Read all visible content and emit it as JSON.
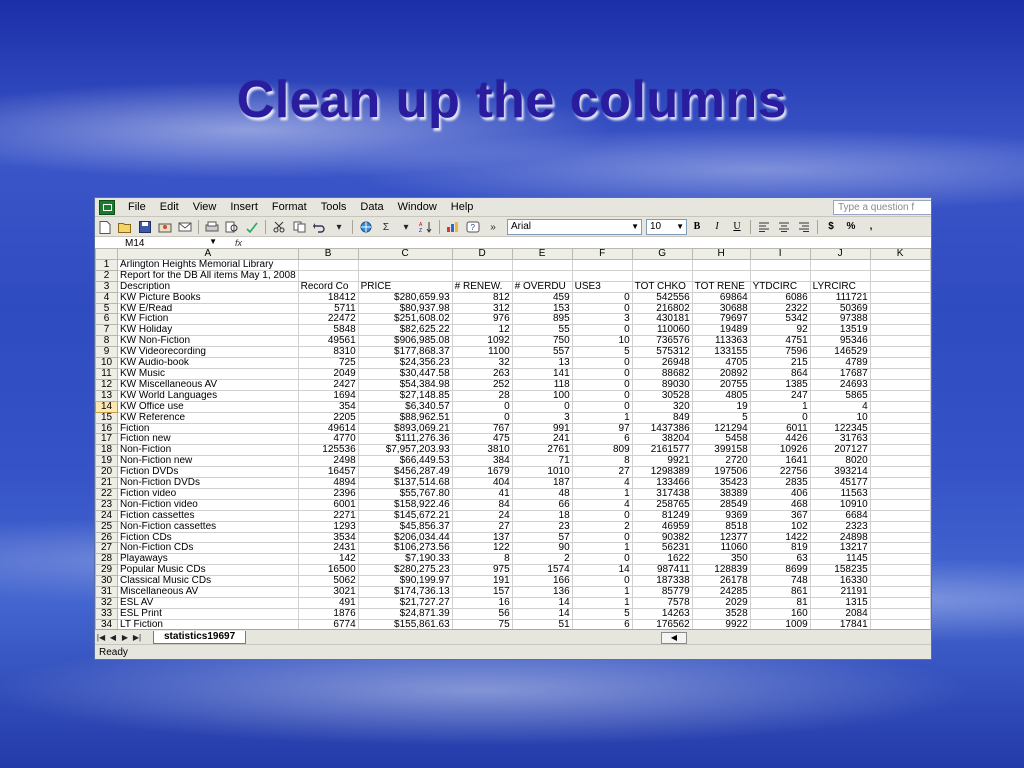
{
  "slide": {
    "title": "Clean up the columns"
  },
  "excel": {
    "menu": [
      "File",
      "Edit",
      "View",
      "Insert",
      "Format",
      "Tools",
      "Data",
      "Window",
      "Help"
    ],
    "question_placeholder": "Type a question f",
    "toolbar": {
      "font": "Arial",
      "font_size": "10",
      "bold": "B",
      "italic": "I",
      "underline": "U",
      "currency": "$",
      "percent": "%",
      "comma": ","
    },
    "name_box": "M14",
    "fx": "fx",
    "columns": [
      "A",
      "B",
      "C",
      "D",
      "E",
      "F",
      "G",
      "H",
      "I",
      "J",
      "K"
    ],
    "active_row": 14,
    "rows": [
      {
        "n": "1",
        "c": [
          "Arlington Heights Memorial Library",
          "",
          "",
          "",
          "",
          "",
          "",
          "",
          "",
          "",
          ""
        ]
      },
      {
        "n": "2",
        "c": [
          "Report for the DB All items May 1, 2008",
          "",
          "",
          "",
          "",
          "",
          "",
          "",
          "",
          "",
          ""
        ]
      },
      {
        "n": "3",
        "c": [
          "Description",
          "Record Co",
          "PRICE",
          "# RENEW.",
          "# OVERDU",
          "USE3",
          "TOT CHKO",
          "TOT RENE",
          "YTDCIRC",
          "LYRCIRC",
          ""
        ]
      },
      {
        "n": "4",
        "c": [
          "KW Picture Books",
          "18412",
          "$280,659.93",
          "812",
          "459",
          "0",
          "542556",
          "69864",
          "6086",
          "111721",
          ""
        ]
      },
      {
        "n": "5",
        "c": [
          "KW E/Read",
          "5711",
          "$80,937.98",
          "312",
          "153",
          "0",
          "216802",
          "30688",
          "2322",
          "50369",
          ""
        ]
      },
      {
        "n": "6",
        "c": [
          "KW Fiction",
          "22472",
          "$251,608.02",
          "976",
          "895",
          "3",
          "430181",
          "79697",
          "5342",
          "97388",
          ""
        ]
      },
      {
        "n": "7",
        "c": [
          "KW Holiday",
          "5848",
          "$82,625.22",
          "12",
          "55",
          "0",
          "110060",
          "19489",
          "92",
          "13519",
          ""
        ]
      },
      {
        "n": "8",
        "c": [
          "KW Non-Fiction",
          "49561",
          "$906,985.08",
          "1092",
          "750",
          "10",
          "736576",
          "113363",
          "4751",
          "95346",
          ""
        ]
      },
      {
        "n": "9",
        "c": [
          "KW Videorecording",
          "8310",
          "$177,868.37",
          "1100",
          "557",
          "5",
          "575312",
          "133155",
          "7596",
          "146529",
          ""
        ]
      },
      {
        "n": "10",
        "c": [
          "KW Audio-book",
          "725",
          "$24,356.23",
          "32",
          "13",
          "0",
          "26948",
          "4705",
          "215",
          "4789",
          ""
        ]
      },
      {
        "n": "11",
        "c": [
          "KW Music",
          "2049",
          "$30,447.58",
          "263",
          "141",
          "0",
          "88682",
          "20892",
          "864",
          "17687",
          ""
        ]
      },
      {
        "n": "12",
        "c": [
          "KW Miscellaneous AV",
          "2427",
          "$54,384.98",
          "252",
          "118",
          "0",
          "89030",
          "20755",
          "1385",
          "24693",
          ""
        ]
      },
      {
        "n": "13",
        "c": [
          "KW World Languages",
          "1694",
          "$27,148.85",
          "28",
          "100",
          "0",
          "30528",
          "4805",
          "247",
          "5865",
          ""
        ]
      },
      {
        "n": "14",
        "c": [
          "KW Office use",
          "354",
          "$6,340.57",
          "0",
          "0",
          "0",
          "320",
          "19",
          "1",
          "4",
          ""
        ]
      },
      {
        "n": "15",
        "c": [
          "KW Reference",
          "2205",
          "$88,962.51",
          "0",
          "3",
          "1",
          "849",
          "5",
          "0",
          "10",
          ""
        ]
      },
      {
        "n": "16",
        "c": [
          "Fiction",
          "49614",
          "$893,069.21",
          "767",
          "991",
          "97",
          "1437386",
          "121294",
          "6011",
          "122345",
          ""
        ]
      },
      {
        "n": "17",
        "c": [
          "Fiction new",
          "4770",
          "$111,276.36",
          "475",
          "241",
          "6",
          "38204",
          "5458",
          "4426",
          "31763",
          ""
        ]
      },
      {
        "n": "18",
        "c": [
          "Non-Fiction",
          "125536",
          "$7,957,203.93",
          "3810",
          "2761",
          "809",
          "2161577",
          "399158",
          "10926",
          "207127",
          ""
        ]
      },
      {
        "n": "19",
        "c": [
          "Non-Fiction new",
          "2498",
          "$66,449.53",
          "384",
          "71",
          "8",
          "9921",
          "2720",
          "1641",
          "8020",
          ""
        ]
      },
      {
        "n": "20",
        "c": [
          "Fiction DVDs",
          "16457",
          "$456,287.49",
          "1679",
          "1010",
          "27",
          "1298389",
          "197506",
          "22756",
          "393214",
          ""
        ]
      },
      {
        "n": "21",
        "c": [
          "Non-Fiction DVDs",
          "4894",
          "$137,514.68",
          "404",
          "187",
          "4",
          "133466",
          "35423",
          "2835",
          "45177",
          ""
        ]
      },
      {
        "n": "22",
        "c": [
          "Fiction video",
          "2396",
          "$55,767.80",
          "41",
          "48",
          "1",
          "317438",
          "38389",
          "406",
          "11563",
          ""
        ]
      },
      {
        "n": "23",
        "c": [
          "Non-Fiction video",
          "6001",
          "$158,922.46",
          "84",
          "66",
          "4",
          "258765",
          "28549",
          "468",
          "10910",
          ""
        ]
      },
      {
        "n": "24",
        "c": [
          "Fiction cassettes",
          "2271",
          "$145,672.21",
          "24",
          "18",
          "0",
          "81249",
          "9369",
          "367",
          "6684",
          ""
        ]
      },
      {
        "n": "25",
        "c": [
          "Non-Fiction cassettes",
          "1293",
          "$45,856.37",
          "27",
          "23",
          "2",
          "46959",
          "8518",
          "102",
          "2323",
          ""
        ]
      },
      {
        "n": "26",
        "c": [
          "Fiction CDs",
          "3534",
          "$206,034.44",
          "137",
          "57",
          "0",
          "90382",
          "12377",
          "1422",
          "24898",
          ""
        ]
      },
      {
        "n": "27",
        "c": [
          "Non-Fiction CDs",
          "2431",
          "$106,273.56",
          "122",
          "90",
          "1",
          "56231",
          "11060",
          "819",
          "13217",
          ""
        ]
      },
      {
        "n": "28",
        "c": [
          "Playaways",
          "142",
          "$7,190.33",
          "8",
          "2",
          "0",
          "1622",
          "350",
          "63",
          "1145",
          ""
        ]
      },
      {
        "n": "29",
        "c": [
          "Popular Music CDs",
          "16500",
          "$280,275.23",
          "975",
          "1574",
          "14",
          "987411",
          "128839",
          "8699",
          "158235",
          ""
        ]
      },
      {
        "n": "30",
        "c": [
          "Classical Music CDs",
          "5062",
          "$90,199.97",
          "191",
          "166",
          "0",
          "187338",
          "26178",
          "748",
          "16330",
          ""
        ]
      },
      {
        "n": "31",
        "c": [
          "Miscellaneous AV",
          "3021",
          "$174,736.13",
          "157",
          "136",
          "1",
          "85779",
          "24285",
          "861",
          "21191",
          ""
        ]
      },
      {
        "n": "32",
        "c": [
          "ESL AV",
          "491",
          "$21,727.27",
          "16",
          "14",
          "1",
          "7578",
          "2029",
          "81",
          "1315",
          ""
        ]
      },
      {
        "n": "33",
        "c": [
          "ESL Print",
          "1876",
          "$24,871.39",
          "56",
          "14",
          "5",
          "14263",
          "3528",
          "160",
          "2084",
          ""
        ]
      },
      {
        "n": "34",
        "c": [
          "LT Fiction",
          "6774",
          "$155,861.63",
          "75",
          "51",
          "6",
          "176562",
          "9922",
          "1009",
          "17841",
          ""
        ]
      }
    ],
    "sheet_tab": "statistics19697",
    "status": "Ready"
  }
}
